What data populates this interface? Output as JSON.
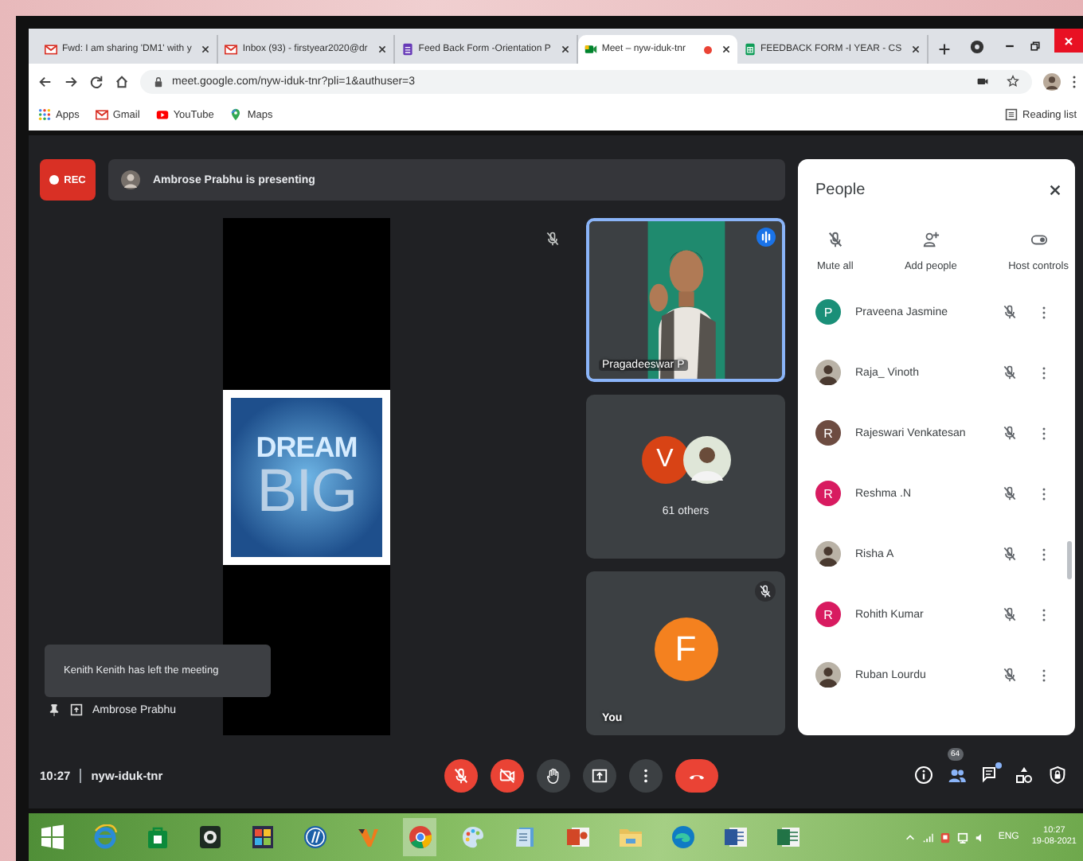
{
  "browser": {
    "tabs": [
      {
        "kind": "mail",
        "title": "Fwd: I am sharing 'DM1' with y",
        "selected": false,
        "recording": false
      },
      {
        "kind": "mail",
        "title": "Inbox (93) - firstyear2020@dr",
        "selected": false,
        "recording": false
      },
      {
        "kind": "forms",
        "title": "Feed Back Form -Orientation P",
        "selected": false,
        "recording": false
      },
      {
        "kind": "meet",
        "title": "Meet – nyw-iduk-tnr",
        "selected": true,
        "recording": true
      },
      {
        "kind": "sheets",
        "title": "FEEDBACK FORM -I YEAR - CS",
        "selected": false,
        "recording": false
      }
    ],
    "address": "meet.google.com/nyw-iduk-tnr?pli=1&authuser=3",
    "bookmarks": [
      {
        "kind": "apps",
        "label": "Apps"
      },
      {
        "kind": "mail",
        "label": "Gmail"
      },
      {
        "kind": "video",
        "label": "YouTube"
      },
      {
        "kind": "maps",
        "label": "Maps"
      }
    ],
    "reading_list": "Reading list"
  },
  "meeting": {
    "recording_label": "REC",
    "presenter_banner": "Ambrose Prabhu is presenting",
    "slide_lines": [
      "DREAM",
      "BIG"
    ],
    "pinned_label": "Ambrose Prabhu",
    "toast": "Kenith Kenith has left the meeting",
    "tiles": [
      {
        "kind": "video",
        "name": "Pragadeeswar P",
        "selected": true,
        "speaking": true
      },
      {
        "kind": "group",
        "letter": "V",
        "color": "#d84315",
        "caption": "61 others",
        "selected": false
      },
      {
        "kind": "avatar",
        "letter": "F",
        "color": "#f4811f",
        "name": "You",
        "muted": true,
        "selected": false
      }
    ],
    "time": "10:27",
    "code": "nyw-iduk-tnr",
    "controls": [
      {
        "kind": "mic",
        "on": false
      },
      {
        "kind": "camera",
        "on": false
      },
      {
        "kind": "hand"
      },
      {
        "kind": "present"
      },
      {
        "kind": "more"
      },
      {
        "kind": "end"
      }
    ],
    "side_buttons": [
      {
        "kind": "info"
      },
      {
        "kind": "people",
        "badge": "64",
        "selected": true
      },
      {
        "kind": "chat",
        "dot": true
      },
      {
        "kind": "activities"
      },
      {
        "kind": "safety"
      }
    ]
  },
  "people_panel": {
    "title": "People",
    "actions": [
      {
        "kind": "mute",
        "label": "Mute all"
      },
      {
        "kind": "add",
        "label": "Add people"
      },
      {
        "kind": "host",
        "label": "Host controls"
      }
    ],
    "participants": [
      {
        "name": "Praveena Jasmine",
        "kind": "letter",
        "letter": "P",
        "color": "#1a8f78"
      },
      {
        "name": "Raja_ Vinoth"
      },
      {
        "name": "Rajeswari Venkatesan",
        "kind": "letter",
        "letter": "R",
        "color": "#6d4c41"
      },
      {
        "name": "Reshma .N",
        "kind": "letter",
        "letter": "R",
        "color": "#d81b60"
      },
      {
        "name": "Risha A"
      },
      {
        "name": "Rohith Kumar",
        "kind": "letter",
        "letter": "R",
        "color": "#d81b60"
      },
      {
        "name": "Ruban Lourdu"
      }
    ]
  },
  "taskbar": {
    "language": "ENG",
    "time": "10:27",
    "date": "19-08-2021"
  }
}
